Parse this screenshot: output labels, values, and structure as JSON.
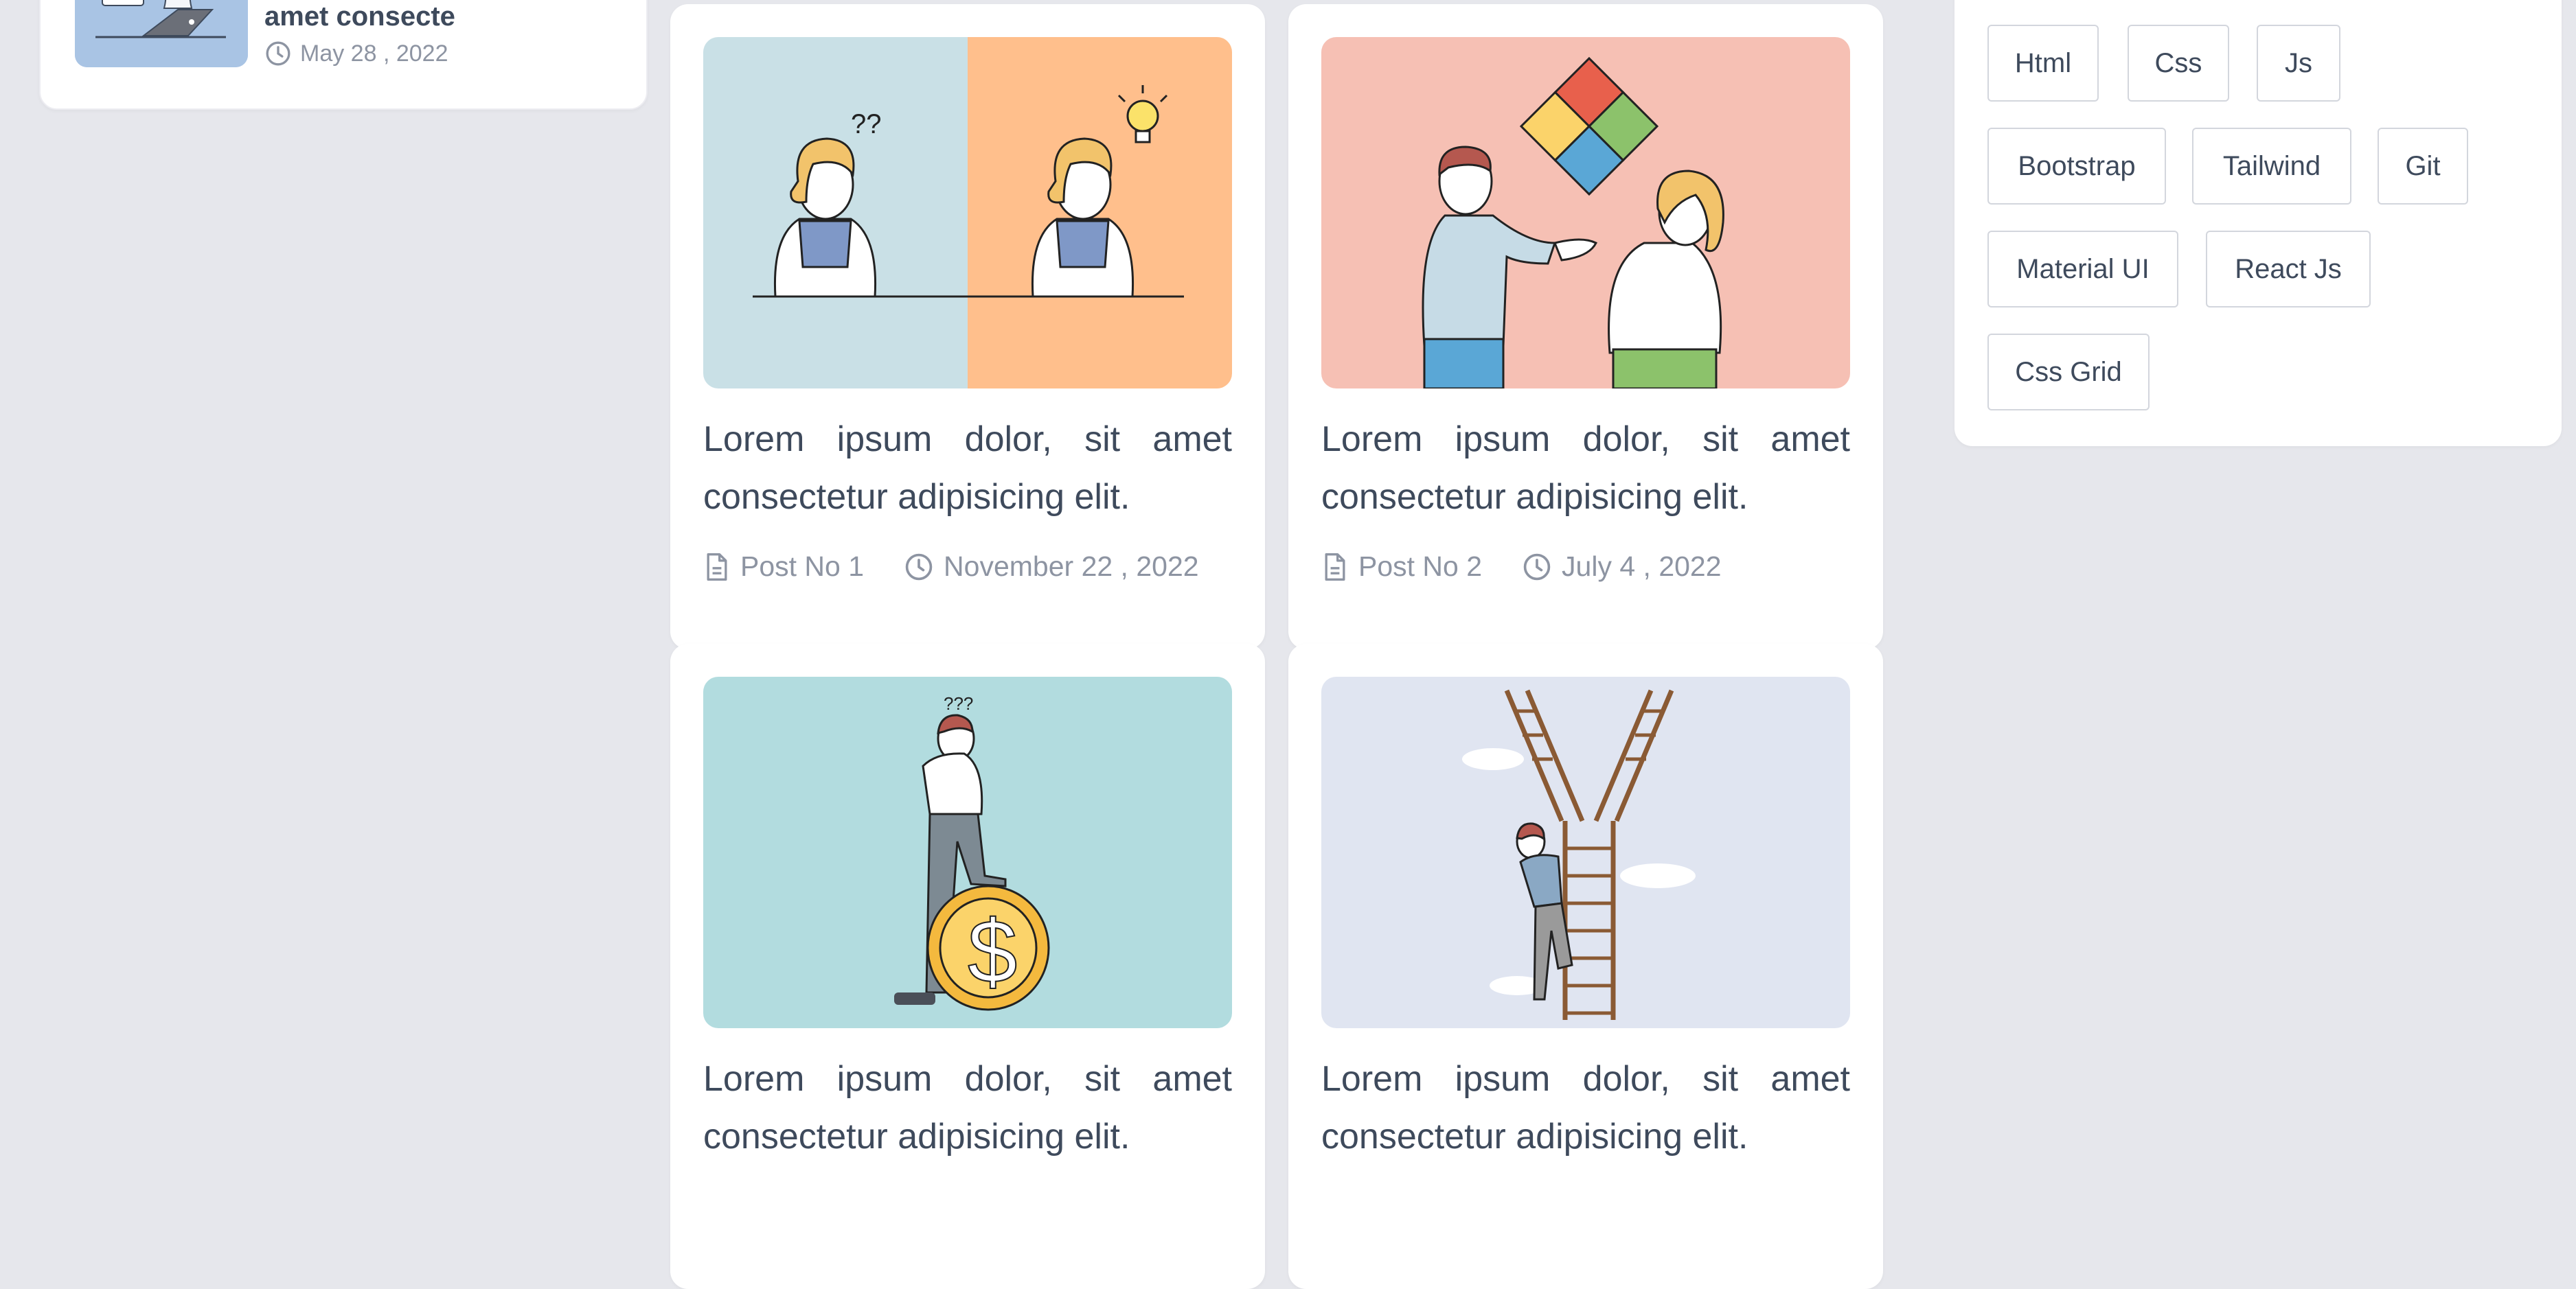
{
  "sidebar_post": {
    "title": "amet consecte",
    "date": "May 28 , 2022"
  },
  "posts": [
    {
      "title": "Lorem ipsum dolor, sit amet consectetur adipisicing elit.",
      "post_no": "Post No 1",
      "date": "November 22 , 2022",
      "thumb_bg": "#c9e0e6"
    },
    {
      "title": "Lorem ipsum dolor, sit amet consectetur adipisicing elit.",
      "post_no": "Post No 2",
      "date": "July 4 , 2022",
      "thumb_bg": "#f6c0b4"
    },
    {
      "title": "Lorem ipsum dolor, sit amet consectetur adipisicing elit.",
      "thumb_bg": "#b2dcdf"
    },
    {
      "title": "Lorem ipsum dolor, sit amet consectetur adipisicing elit.",
      "thumb_bg": "#e0e5f1"
    }
  ],
  "tags": [
    "Html",
    "Css",
    "Js",
    "Bootstrap",
    "Tailwind",
    "Git",
    "Material UI",
    "React Js",
    "Css Grid"
  ],
  "colors": {
    "background": "#e6e7ec",
    "card": "#ffffff",
    "text": "#3e4a5c",
    "meta_text": "#8d94a2",
    "tag_border": "#d3d6dd"
  },
  "icons": {
    "post_no": "document-icon",
    "date": "clock-icon"
  }
}
